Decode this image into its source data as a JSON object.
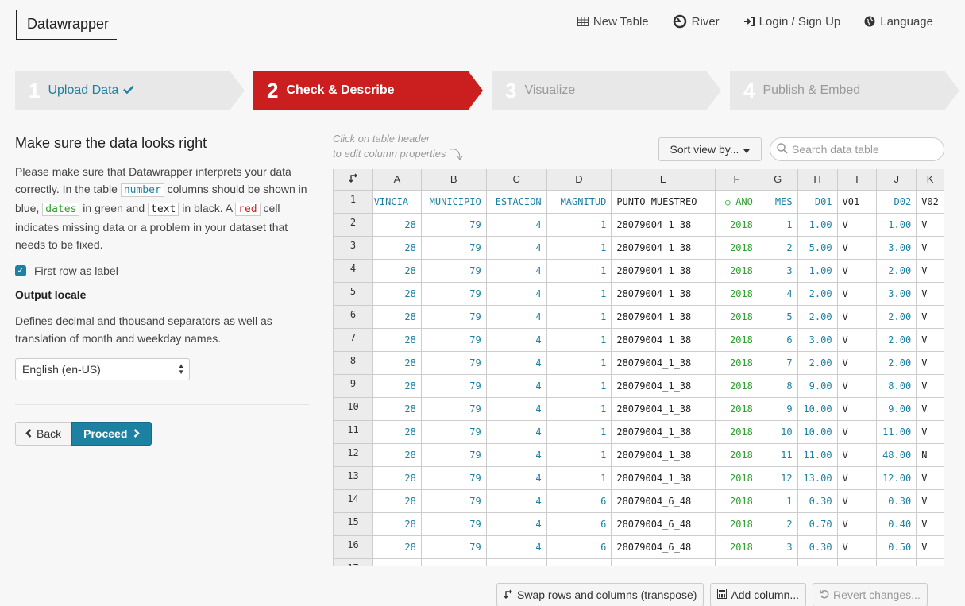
{
  "brand": "Datawrapper",
  "topnav": [
    {
      "label": "New Table",
      "icon": "table-icon"
    },
    {
      "label": "River",
      "icon": "river-icon"
    },
    {
      "label": "Login / Sign Up",
      "icon": "login-icon"
    },
    {
      "label": "Language",
      "icon": "globe-icon"
    }
  ],
  "steps": [
    {
      "num": "1",
      "label": "Upload Data",
      "state": "done"
    },
    {
      "num": "2",
      "label": "Check & Describe",
      "state": "active"
    },
    {
      "num": "3",
      "label": "Visualize",
      "state": "todo"
    },
    {
      "num": "4",
      "label": "Publish & Embed",
      "state": "todo"
    }
  ],
  "left": {
    "title": "Make sure the data looks right",
    "desc_1": "Please make sure that Datawrapper interprets your data correctly. In the table",
    "code_number": "number",
    "desc_2": "columns should be shown in blue,",
    "code_dates": "dates",
    "desc_3": "in green and",
    "code_text": "text",
    "desc_4": "in black. A",
    "code_red": "red",
    "desc_5": "cell indicates missing data or a problem in your dataset that needs to be fixed.",
    "first_row_label": "First row as label",
    "first_row_checked": true,
    "locale_title": "Output locale",
    "locale_desc": "Defines decimal and thousand separators as well as translation of month and weekday names.",
    "locale_value": "English (en-US)",
    "back_label": "Back",
    "proceed_label": "Proceed"
  },
  "table_hint_1": "Click on table header",
  "table_hint_2": "to edit column properties",
  "sort_label": "Sort view by...",
  "search_placeholder": "Search data table",
  "table": {
    "col_letters": [
      "A",
      "B",
      "C",
      "D",
      "E",
      "F",
      "G",
      "H",
      "I",
      "J",
      "K"
    ],
    "header_row": [
      "PROVINCIA",
      "MUNICIPIO",
      "ESTACION",
      "MAGNITUD",
      "PUNTO_MUESTREO",
      "ANO",
      "MES",
      "D01",
      "V01",
      "D02",
      "V02"
    ],
    "header_types": [
      "n",
      "n",
      "n",
      "n",
      "t",
      "d",
      "n",
      "n",
      "t",
      "n",
      "t"
    ],
    "rows": [
      [
        "28",
        "79",
        "4",
        "1",
        "28079004_1_38",
        "2018",
        "1",
        "1.00",
        "V",
        "1.00",
        "V"
      ],
      [
        "28",
        "79",
        "4",
        "1",
        "28079004_1_38",
        "2018",
        "2",
        "5.00",
        "V",
        "3.00",
        "V"
      ],
      [
        "28",
        "79",
        "4",
        "1",
        "28079004_1_38",
        "2018",
        "3",
        "1.00",
        "V",
        "2.00",
        "V"
      ],
      [
        "28",
        "79",
        "4",
        "1",
        "28079004_1_38",
        "2018",
        "4",
        "2.00",
        "V",
        "3.00",
        "V"
      ],
      [
        "28",
        "79",
        "4",
        "1",
        "28079004_1_38",
        "2018",
        "5",
        "2.00",
        "V",
        "2.00",
        "V"
      ],
      [
        "28",
        "79",
        "4",
        "1",
        "28079004_1_38",
        "2018",
        "6",
        "3.00",
        "V",
        "2.00",
        "V"
      ],
      [
        "28",
        "79",
        "4",
        "1",
        "28079004_1_38",
        "2018",
        "7",
        "2.00",
        "V",
        "2.00",
        "V"
      ],
      [
        "28",
        "79",
        "4",
        "1",
        "28079004_1_38",
        "2018",
        "8",
        "9.00",
        "V",
        "8.00",
        "V"
      ],
      [
        "28",
        "79",
        "4",
        "1",
        "28079004_1_38",
        "2018",
        "9",
        "10.00",
        "V",
        "9.00",
        "V"
      ],
      [
        "28",
        "79",
        "4",
        "1",
        "28079004_1_38",
        "2018",
        "10",
        "10.00",
        "V",
        "11.00",
        "V"
      ],
      [
        "28",
        "79",
        "4",
        "1",
        "28079004_1_38",
        "2018",
        "11",
        "11.00",
        "V",
        "48.00",
        "N"
      ],
      [
        "28",
        "79",
        "4",
        "1",
        "28079004_1_38",
        "2018",
        "12",
        "13.00",
        "V",
        "12.00",
        "V"
      ],
      [
        "28",
        "79",
        "4",
        "6",
        "28079004_6_48",
        "2018",
        "1",
        "0.30",
        "V",
        "0.30",
        "V"
      ],
      [
        "28",
        "79",
        "4",
        "6",
        "28079004_6_48",
        "2018",
        "2",
        "0.70",
        "V",
        "0.40",
        "V"
      ],
      [
        "28",
        "79",
        "4",
        "6",
        "28079004_6_48",
        "2018",
        "3",
        "0.30",
        "V",
        "0.50",
        "V"
      ]
    ],
    "col_types": [
      "n",
      "n",
      "n",
      "n",
      "t",
      "d",
      "n",
      "n",
      "t",
      "n",
      "t"
    ]
  },
  "bottom_buttons": [
    {
      "label": "Swap rows and columns (transpose)",
      "icon": "swap-icon",
      "disabled": false
    },
    {
      "label": "Add column...",
      "icon": "calculator-icon",
      "disabled": false
    },
    {
      "label": "Revert changes...",
      "icon": "undo-icon",
      "disabled": true
    }
  ],
  "colors": {
    "accent": "#1d81a2",
    "active_step": "#cb1e1f",
    "date_green": "#2ca02c"
  }
}
